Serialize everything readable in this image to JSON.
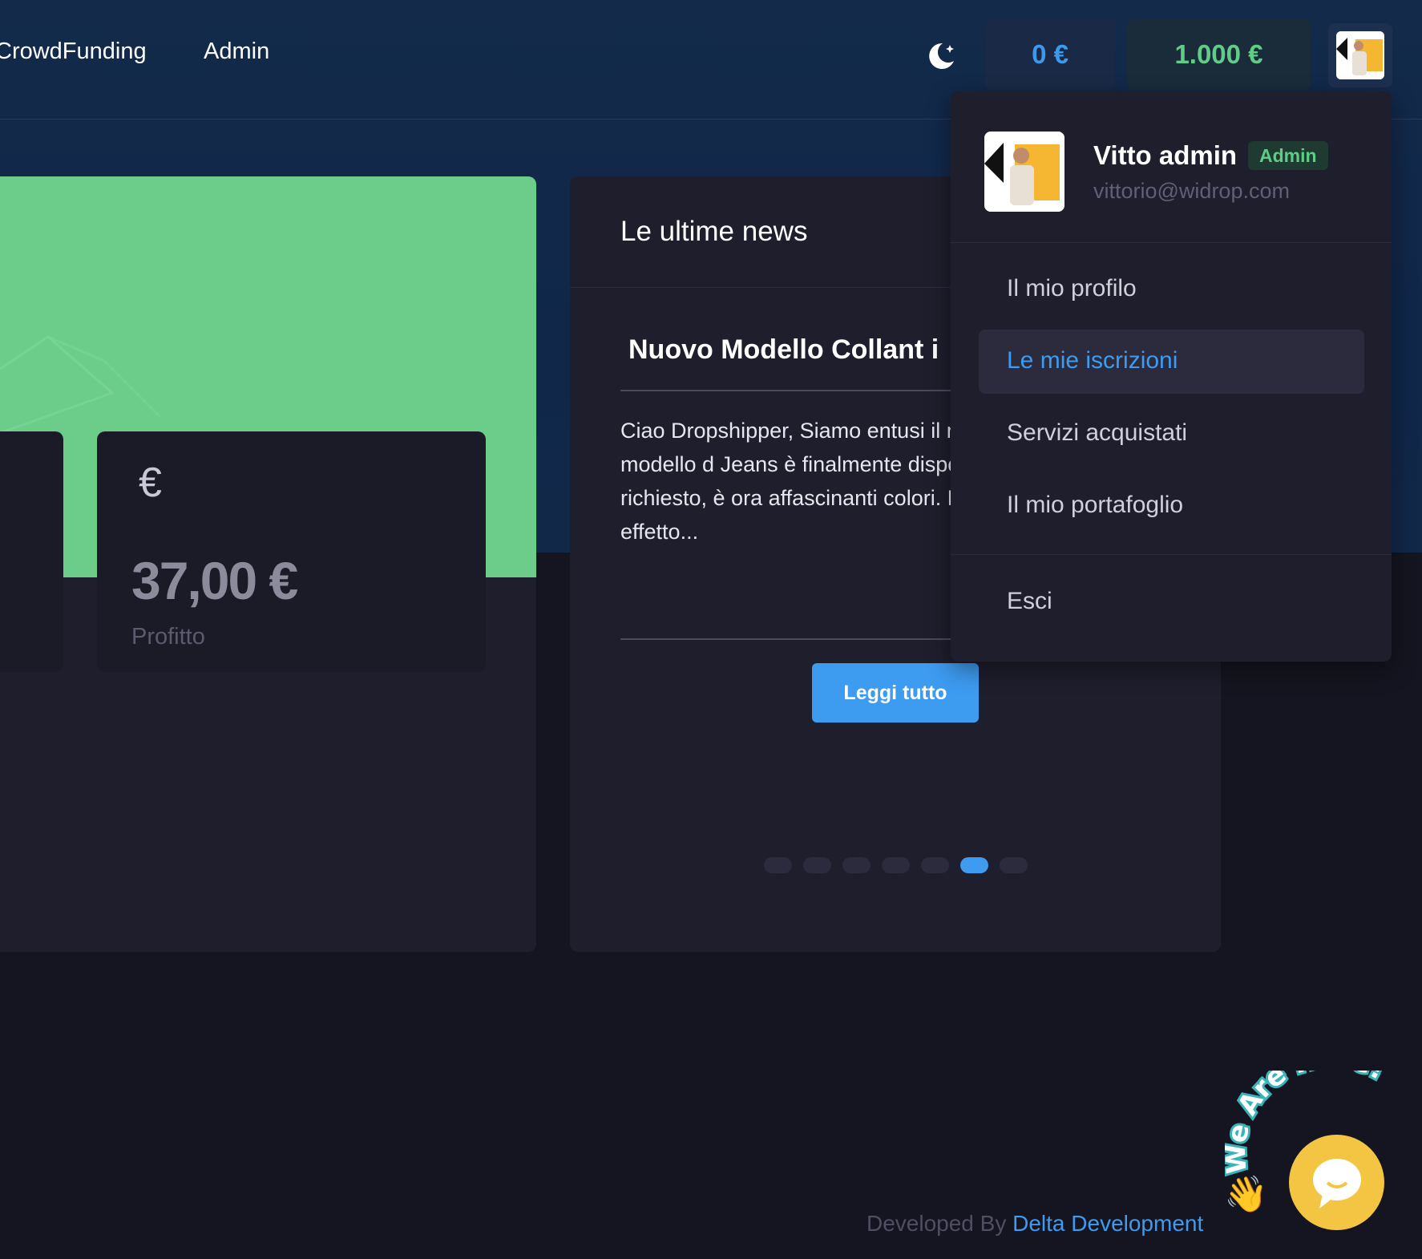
{
  "nav": {
    "crowdfunding": "CrowdFunding",
    "admin": "Admin"
  },
  "header": {
    "theme_icon": "moon-icon",
    "balance_1": "0 €",
    "balance_2": "1.000 €"
  },
  "stats": {
    "value": "37,00 €",
    "label": "Profitto",
    "icon": "euro-icon"
  },
  "news": {
    "title": "Le ultime news",
    "article_title": "Nuovo Modello Collant i",
    "article_body": "Ciao Dropshipper, Siamo entusi il nostro tanto atteso modello d Jeans è finalmente disponibile i prodotto, molto richiesto, è ora affascinanti colori. Dettagli del Collant con effetto...",
    "read_more": "Leggi tutto",
    "dots": [
      false,
      false,
      false,
      false,
      false,
      true,
      false
    ]
  },
  "user_menu": {
    "name": "Vitto admin",
    "role": "Admin",
    "email": "vittorio@widrop.com",
    "items": [
      {
        "label": "Il mio profilo",
        "active": false
      },
      {
        "label": "Le mie iscrizioni",
        "active": true
      },
      {
        "label": "Servizi acquistati",
        "active": false
      },
      {
        "label": "Il mio portafoglio",
        "active": false
      }
    ],
    "logout": "Esci"
  },
  "footer": {
    "prefix": "Developed By",
    "brand": "Delta Development"
  },
  "chat": {
    "text": "We Are Here!",
    "icon": "chat-icon",
    "wave": "waving-hand-icon"
  },
  "colors": {
    "accent": "#3d9bf0",
    "success": "#5fcd87",
    "hero_card": "#6ccd8a"
  }
}
